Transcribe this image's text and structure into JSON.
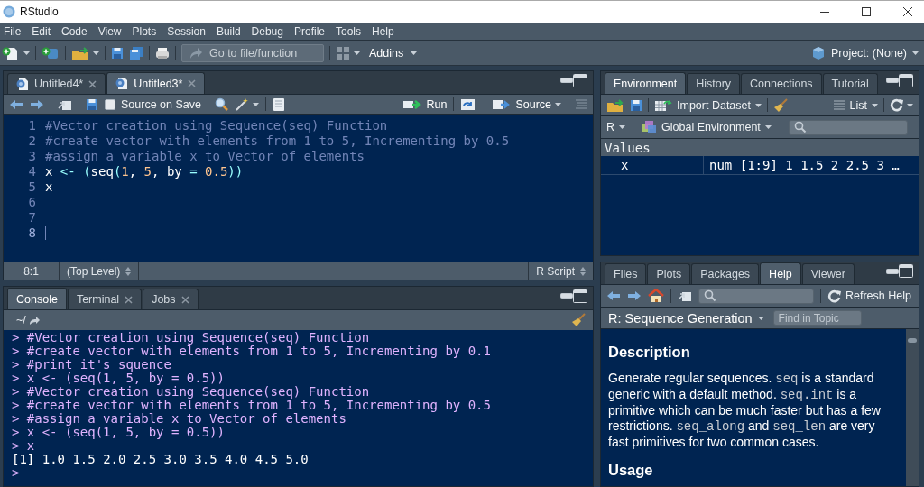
{
  "window": {
    "title": "RStudio"
  },
  "menu": [
    "File",
    "Edit",
    "Code",
    "View",
    "Plots",
    "Session",
    "Build",
    "Debug",
    "Profile",
    "Tools",
    "Help"
  ],
  "toolbar": {
    "goto_placeholder": "Go to file/function",
    "addins": "Addins",
    "project": "Project: (None)"
  },
  "editor": {
    "tabs": [
      {
        "label": "Untitled4*",
        "selected": false,
        "closable": true
      },
      {
        "label": "Untitled3*",
        "selected": true,
        "closable": true
      }
    ],
    "source_on_save": {
      "label": "Source on Save",
      "checked": false
    },
    "run": "Run",
    "source": "Source",
    "lines": [
      {
        "number": "1",
        "cursor": false,
        "tokens": [
          {
            "text": "#Vector creation using Sequence(seq) Function",
            "kind": "comment"
          }
        ]
      },
      {
        "number": "2",
        "cursor": false,
        "tokens": [
          {
            "text": "#create vector with elements from 1 to 5, Incrementing by 0.5",
            "kind": "comment"
          }
        ]
      },
      {
        "number": "3",
        "cursor": false,
        "tokens": [
          {
            "text": "#assign a variable x to Vector of elements",
            "kind": "comment"
          }
        ]
      },
      {
        "number": "4",
        "cursor": false,
        "tokens": [
          {
            "text": "x ",
            "kind": "text"
          },
          {
            "text": "<-",
            "kind": "operator"
          },
          {
            "text": " (",
            "kind": "paren"
          },
          {
            "text": "seq",
            "kind": "text"
          },
          {
            "text": "(",
            "kind": "paren"
          },
          {
            "text": "1",
            "kind": "number"
          },
          {
            "text": ", ",
            "kind": "text"
          },
          {
            "text": "5",
            "kind": "number"
          },
          {
            "text": ", by ",
            "kind": "text"
          },
          {
            "text": "= ",
            "kind": "operator"
          },
          {
            "text": "0.5",
            "kind": "number"
          },
          {
            "text": "))",
            "kind": "paren"
          }
        ]
      },
      {
        "number": "5",
        "cursor": false,
        "tokens": [
          {
            "text": "x",
            "kind": "text"
          }
        ]
      },
      {
        "number": "6",
        "cursor": false
      },
      {
        "number": "7",
        "cursor": false
      },
      {
        "number": "8",
        "cursor": true
      }
    ],
    "status": {
      "position": "8:1",
      "scope": "(Top Level)",
      "file_type": "R Script"
    }
  },
  "console": {
    "tabs": [
      {
        "label": "Console",
        "selected": true,
        "closable": false
      },
      {
        "label": "Terminal",
        "selected": false,
        "closable": true
      },
      {
        "label": "Jobs",
        "selected": false,
        "closable": true
      }
    ],
    "path": "~/",
    "lines": [
      {
        "kind": "input",
        "prompt": ">",
        "text": "#Vector creation using Sequence(seq) Function"
      },
      {
        "kind": "input",
        "prompt": ">",
        "text": "#create vector with elements from 1 to 5, Incrementing by 0.1"
      },
      {
        "kind": "input",
        "prompt": ">",
        "text": "#print it's squence"
      },
      {
        "kind": "input",
        "prompt": ">",
        "text": "x <- (seq(1, 5, by = 0.5))"
      },
      {
        "kind": "input",
        "prompt": ">",
        "text": "#Vector creation using Sequence(seq) Function"
      },
      {
        "kind": "input",
        "prompt": ">",
        "text": "#create vector with elements from 1 to 5, Incrementing by 0.5"
      },
      {
        "kind": "input",
        "prompt": ">",
        "text": "#assign a variable x to Vector of elements"
      },
      {
        "kind": "input",
        "prompt": ">",
        "text": "x <- (seq(1, 5, by = 0.5))"
      },
      {
        "kind": "input",
        "prompt": ">",
        "text": "x"
      },
      {
        "kind": "output",
        "text": "[1] 1.0 1.5 2.0 2.5 3.0 3.5 4.0 4.5 5.0"
      },
      {
        "kind": "prompt",
        "prompt": ">"
      }
    ]
  },
  "environment": {
    "tabs": [
      {
        "label": "Environment",
        "selected": true
      },
      {
        "label": "History",
        "selected": false
      },
      {
        "label": "Connections",
        "selected": false
      },
      {
        "label": "Tutorial",
        "selected": false
      }
    ],
    "import": "Import Dataset",
    "view": "List",
    "language": "R",
    "scope": "Global Environment",
    "section": "Values",
    "rows": [
      {
        "name": "x",
        "value": "num [1:9] 1 1.5 2 2.5 3 …"
      }
    ]
  },
  "help_pane": {
    "tabs": [
      {
        "label": "Files",
        "selected": false
      },
      {
        "label": "Plots",
        "selected": false
      },
      {
        "label": "Packages",
        "selected": false
      },
      {
        "label": "Help",
        "selected": true
      },
      {
        "label": "Viewer",
        "selected": false
      }
    ],
    "refresh": "Refresh Help",
    "topic": "R: Sequence Generation",
    "find_placeholder": "Find in Topic",
    "sections": [
      {
        "kind": "heading",
        "text": "Description"
      },
      {
        "kind": "paragraph",
        "segments": [
          {
            "text": "Generate regular sequences. ",
            "kind": "text"
          },
          {
            "text": "seq",
            "kind": "code"
          },
          {
            "text": " is a standard generic with a default method. ",
            "kind": "text"
          },
          {
            "text": "seq.int",
            "kind": "code"
          },
          {
            "text": " is a primitive which can be much faster but has a few restrictions. ",
            "kind": "text"
          },
          {
            "text": "seq_along",
            "kind": "code"
          },
          {
            "text": " and ",
            "kind": "text"
          },
          {
            "text": "seq_len",
            "kind": "code"
          },
          {
            "text": " are very fast primitives for two common cases.",
            "kind": "text"
          }
        ]
      },
      {
        "kind": "heading",
        "text": "Usage"
      }
    ]
  }
}
